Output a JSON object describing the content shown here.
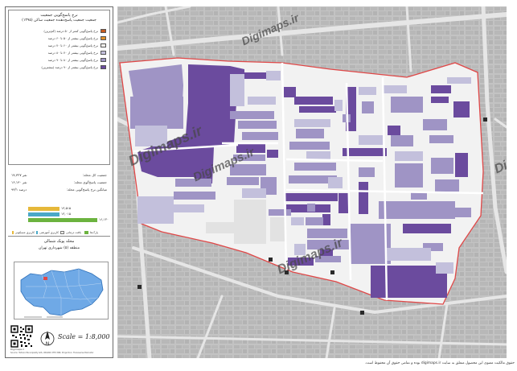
{
  "legend": {
    "title": "نرخ پاسخ‌گویی جمعیت",
    "subtitle": "جمعیت جمعیت پاسخ‌دهنده جمعیت ساکن (۱۳۹۵)",
    "items": [
      {
        "label": "نرخ پاسخ‌گویی کمتر از ۵۰ درصد (کم‌ترین)",
        "color": "#c75a1e"
      },
      {
        "label": "نرخ پاسخ‌گویی بیشتر از ۵۰ تا ۶۰ درصد",
        "color": "#e0922a"
      },
      {
        "label": "نرخ پاسخ‌گویی بیشتر از ۶۰ تا ۷۰ درصد",
        "color": "#f3f1ec"
      },
      {
        "label": "نرخ پاسخ‌گویی بیشتر از ۷۰ تا ۸۰ درصد",
        "color": "#c3c0dc"
      },
      {
        "label": "نرخ پاسخ‌گویی بیشتر از ۸۰ تا ۹۰ درصد",
        "color": "#9f94c5"
      },
      {
        "label": "نرخ پاسخ‌گویی بیشتر از ۹۰ درصد (بیشترین)",
        "color": "#6b4b9e"
      }
    ]
  },
  "stats": {
    "rows": [
      {
        "key": "جمعیت کل محله:",
        "value": "۱۷,۳۲۷ نفر"
      },
      {
        "key": "جمعیت پاسخ‌گوی محله:",
        "value": "۱۶,۱۳۰ نفر"
      },
      {
        "key": "میانگین نرخ پاسخ‌گویی محله:",
        "value": "۹۳/۱ درصد"
      }
    ],
    "bars": [
      {
        "label": "۱۳,۵۱۵",
        "fraction": 0.39,
        "color": "#e6b83a"
      },
      {
        "label": "۱۳,۰۱۵",
        "fraction": 0.39,
        "color": "#4aa8c7"
      },
      {
        "label": "۱۶,۱۳۰",
        "fraction": 0.86,
        "color": "#6cb33f"
      }
    ]
  },
  "land_use": [
    {
      "label": "کاربری مسکونی",
      "color": "#e6b83a"
    },
    {
      "label": "کاربری آموزشی",
      "color": "#4aa8c7"
    },
    {
      "label": "بافت درمانی",
      "color": "#f3f1ec"
    },
    {
      "label": "پارک‌ها",
      "color": "#6cb33f"
    }
  ],
  "mahalle": {
    "title": "محله پونک شمالی",
    "subtitle": "منطقه (۵) شهرداری تهران"
  },
  "scale_text": "Scale = 1:8,000",
  "logo_text": "Digimaps.ir",
  "credits_text": "Source: Tehran Municipality GIS, WGS84 UTM 39N, Projection: Transverse Mercator",
  "watermark_text": "Digimaps.ir",
  "copyright_text": "حقوق مالکیت معنوی این محصول متعلق به سایت digimaps.ir بوده و تمامی حقوق آن محفوظ است.",
  "colors": {
    "boundary": "#e04848",
    "road": "#efefef",
    "background_blocks": "#bdbdbd",
    "dark": "#6b4b9e",
    "mid": "#9f94c5",
    "light": "#c3c0dc"
  }
}
